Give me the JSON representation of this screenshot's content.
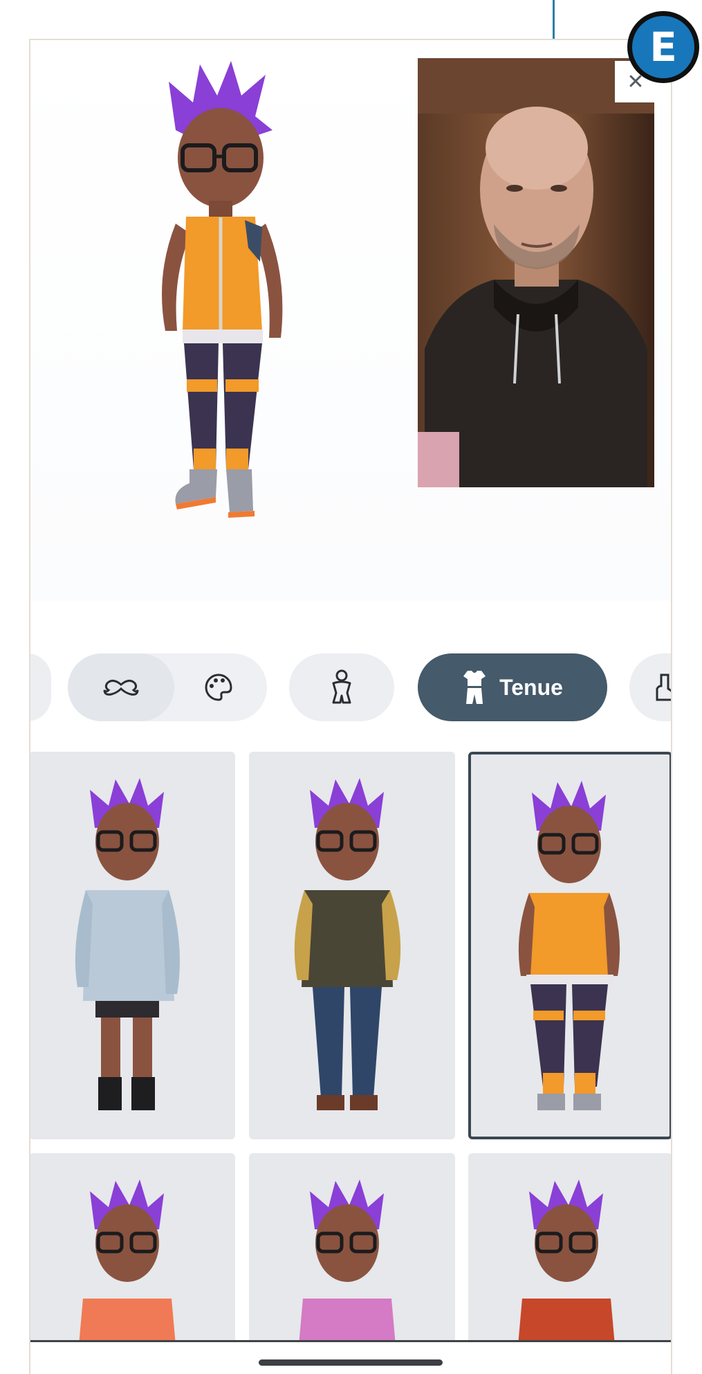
{
  "callout": {
    "badge_letter": "E"
  },
  "camera": {
    "close_glyph": "✕"
  },
  "categories": {
    "items": [
      {
        "icon": "mustache-icon",
        "label": ""
      },
      {
        "icon": "palette-icon",
        "label": ""
      },
      {
        "icon": "body-icon",
        "label": ""
      },
      {
        "icon": "outfit-icon",
        "label": "Tenue",
        "active": true
      },
      {
        "icon": "shoe-icon",
        "label": ""
      }
    ]
  },
  "outfits": {
    "items": [
      {
        "name": "denim-jacket-outfit",
        "top_color": "#b9c9d8",
        "bottom_color": "#2d2a30",
        "selected": false
      },
      {
        "name": "puffer-jacket-outfit",
        "top_color": "#4a4636",
        "bottom_color": "#2f4668",
        "selected": false
      },
      {
        "name": "orange-vest-outfit",
        "top_color": "#f29a2a",
        "bottom_color": "#3b3350",
        "selected": true
      },
      {
        "name": "coral-tee-outfit",
        "top_color": "#f07a55",
        "bottom_color": "",
        "selected": false
      },
      {
        "name": "pink-sweater-outfit",
        "top_color": "#d57ac4",
        "bottom_color": "",
        "selected": false
      },
      {
        "name": "rust-shirt-outfit",
        "top_color": "#c7472a",
        "bottom_color": "",
        "selected": false
      }
    ]
  },
  "colors": {
    "hair": "#8a3fd6",
    "skin": "#8a5340",
    "active_chip": "#455a6a",
    "callout": "#1877ba"
  }
}
